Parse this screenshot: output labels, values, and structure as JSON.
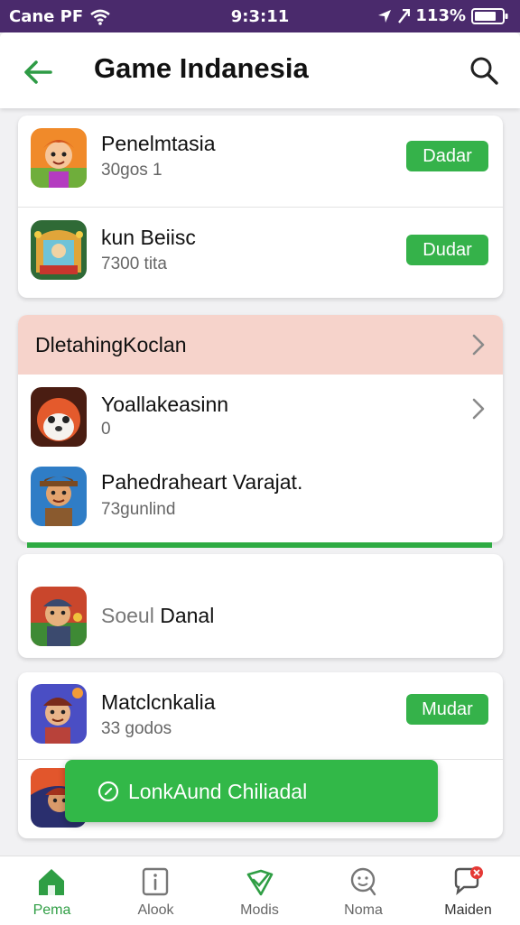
{
  "status_bar": {
    "carrier": "Cane PF",
    "time": "9:3:11",
    "battery": "113%"
  },
  "app_bar": {
    "title": "Game Indanesia",
    "back_icon": "arrow-left-icon",
    "search_icon": "search-icon"
  },
  "colors": {
    "accent": "#35b24a",
    "status_bar": "#4a2a6c",
    "section_header": "#f6d3cb"
  },
  "top_list": [
    {
      "name": "Penelmtasia",
      "sub": "30gos 1",
      "button": "Dadar"
    },
    {
      "name": "kun Beiisc",
      "sub": "7300 tita",
      "button": "Dudar"
    }
  ],
  "section": {
    "title": "DletahingKoclan",
    "items": [
      {
        "name": "Yoallakeasinn",
        "sub": "0"
      },
      {
        "name": "Pahedraheart Varajat.",
        "sub": "73gunlind"
      }
    ]
  },
  "single_item": {
    "name": "Soeu Danal",
    "name_light": "Soeul",
    "name_dark": "Danal"
  },
  "bottom_list": [
    {
      "name": "Matclcnkalia",
      "sub": "33 godos",
      "button": "Mudar"
    }
  ],
  "toast": {
    "text": "LonkAund Chiliadal",
    "icon": "check-circle-icon"
  },
  "bottom_nav": [
    {
      "label": "Pema",
      "icon": "home-icon",
      "active": true
    },
    {
      "label": "Alook",
      "icon": "info-box-icon",
      "active": false
    },
    {
      "label": "Modis",
      "icon": "tag-icon",
      "active": false
    },
    {
      "label": "Noma",
      "icon": "face-chat-icon",
      "active": false
    },
    {
      "label": "Maiden",
      "icon": "chat-badge-icon",
      "active": false,
      "badge": true
    }
  ]
}
